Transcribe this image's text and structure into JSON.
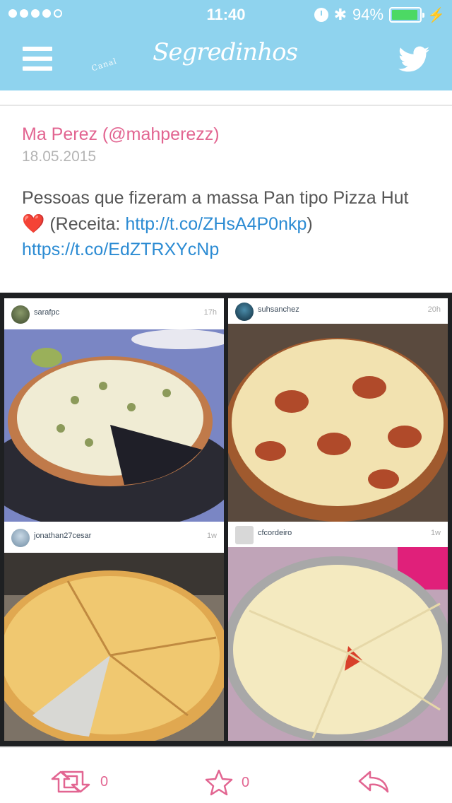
{
  "status_bar": {
    "time": "11:40",
    "battery": "94%",
    "battery_level": 0.94
  },
  "nav": {
    "logo_small": "Canal",
    "logo_main": "Segredinhos"
  },
  "post": {
    "author": "Ma Perez (@mahperezz)",
    "date": "18.05.2015",
    "text_before": "Pessoas que fizeram a massa Pan tipo Pizza Hut ",
    "heart": "❤️",
    "text_receita": " (Receita: ",
    "link1": "http://t.co/ZHsA4P0nkp",
    "text_close": ") ",
    "link2": "https://t.co/EdZTRXYcNp"
  },
  "collage": [
    {
      "username": "sarafpc",
      "time": "17h"
    },
    {
      "username": "suhsanchez",
      "time": "20h"
    },
    {
      "username": "jonathan27cesar",
      "time": "1w"
    },
    {
      "username": "cfcordeiro",
      "time": "1w"
    }
  ],
  "actions": {
    "retweet_count": "0",
    "favorite_count": "0"
  },
  "colors": {
    "nav_bg": "#8fd3ee",
    "accent": "#e26591",
    "link": "#2b8bd3"
  }
}
